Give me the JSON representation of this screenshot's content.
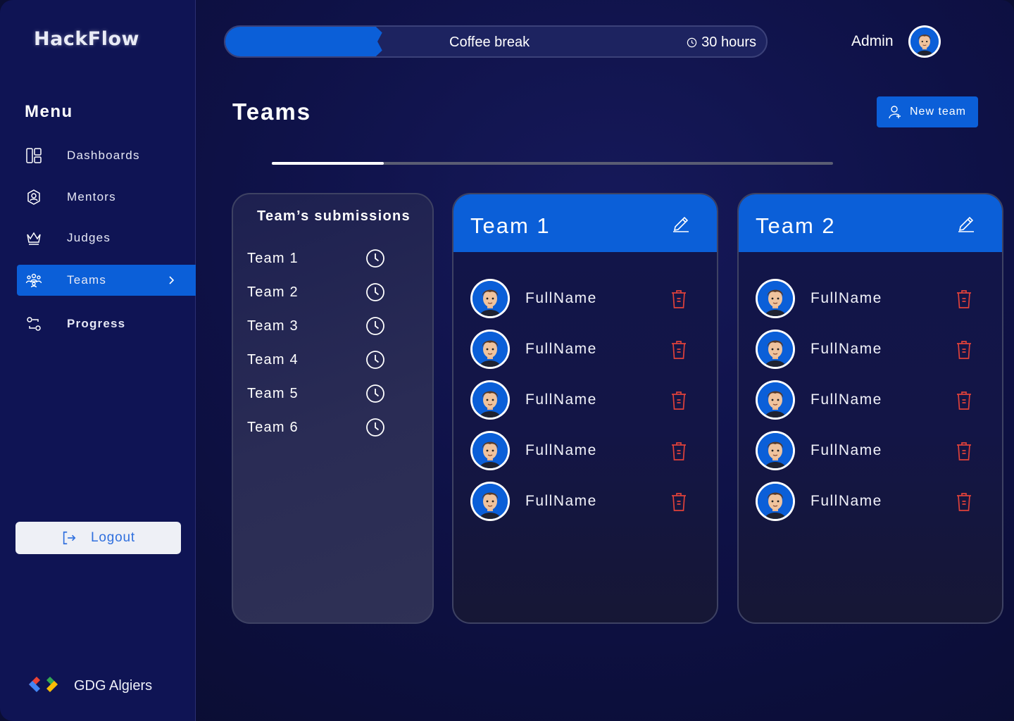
{
  "brand": {
    "logo_text": "HackFlow",
    "footer_text": "GDG Algiers"
  },
  "sidebar": {
    "menu_title": "Menu",
    "items": [
      {
        "label": "Dashboards",
        "icon": "dashboard-icon",
        "active": false
      },
      {
        "label": "Mentors",
        "icon": "mentor-badge-icon",
        "active": false
      },
      {
        "label": "Judges",
        "icon": "crown-icon",
        "active": false
      },
      {
        "label": "Teams",
        "icon": "team-icon",
        "active": true
      },
      {
        "label": "Progress",
        "icon": "progress-icon",
        "active": false
      }
    ],
    "logout_label": "Logout"
  },
  "topbar": {
    "event_label": "Coffee break",
    "time_left": "30 hours",
    "event_progress": 0.29,
    "user_name": "Admin"
  },
  "page": {
    "title": "Teams",
    "new_team_label": "New team",
    "scroll_progress": 0.2
  },
  "submissions": {
    "title": "Team’s submissions",
    "teams": [
      "Team 1",
      "Team 2",
      "Team 3",
      "Team 4",
      "Team 5",
      "Team 6"
    ]
  },
  "teams": [
    {
      "name": "Team 1",
      "members": [
        "FullName",
        "FullName",
        "FullName",
        "FullName",
        "FullName"
      ]
    },
    {
      "name": "Team 2",
      "members": [
        "FullName",
        "FullName",
        "FullName",
        "FullName",
        "FullName"
      ]
    }
  ],
  "colors": {
    "accent": "#0b5fd8",
    "sidebar_bg": "#0f1454",
    "page_bg": "#0e1146",
    "danger": "#e0413a",
    "logout_text": "#2f6fde"
  }
}
